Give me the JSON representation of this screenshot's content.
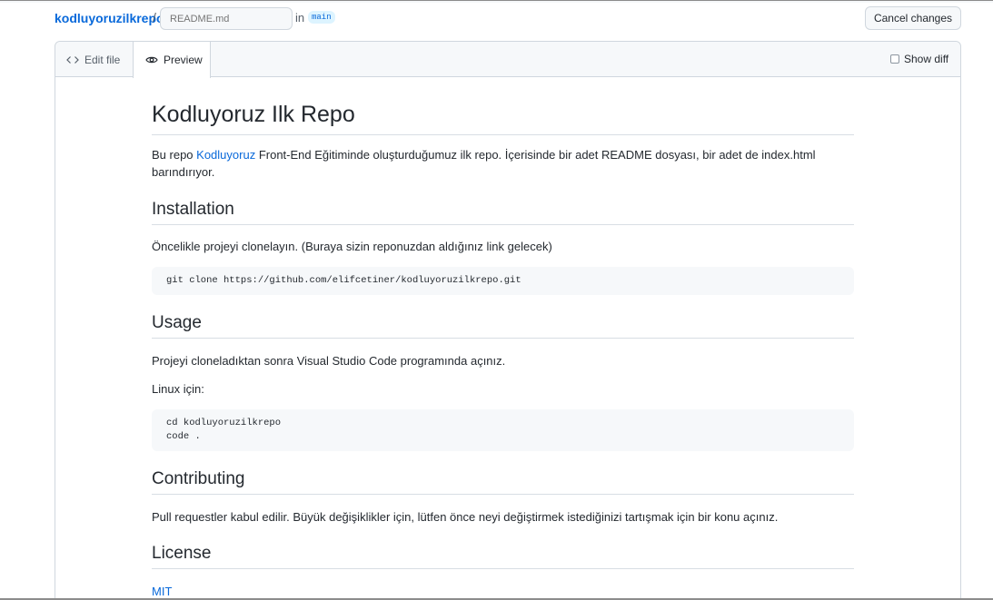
{
  "header": {
    "repo_name": "kodluyoruzilkrepo",
    "separator": "/",
    "filename_placeholder": "README.md",
    "in_label": "in",
    "branch": "main",
    "cancel_label": "Cancel changes"
  },
  "tabs": {
    "edit_label": "Edit file",
    "preview_label": "Preview",
    "show_diff_label": "Show diff"
  },
  "readme": {
    "title": "Kodluyoruz Ilk Repo",
    "intro_prefix": "Bu repo ",
    "intro_link": "Kodluyoruz",
    "intro_suffix_line1": " Front-End Eğitiminde oluşturduğumuz ilk repo. İçerisinde bir adet README dosyası, bir adet de index.html",
    "intro_suffix_line2": "barındırıyor.",
    "installation_heading": "Installation",
    "installation_text": "Öncelikle projeyi clonelayın. (Buraya sizin reponuzdan aldığınız link gelecek)",
    "installation_code": "git clone https://github.com/elifcetiner/kodluyoruzilkrepo.git",
    "usage_heading": "Usage",
    "usage_text": "Projeyi cloneladıktan sonra Visual Studio Code programında açınız.",
    "linux_text": "Linux için:",
    "usage_code_line1": "cd kodluyoruzilkrepo",
    "usage_code_line2": "code .",
    "contributing_heading": "Contributing",
    "contributing_text": "Pull requestler kabul edilir. Büyük değişiklikler için, lütfen önce neyi değiştirmek istediğinizi tartışmak için bir konu açınız.",
    "license_heading": "License",
    "license_link": "MIT"
  }
}
